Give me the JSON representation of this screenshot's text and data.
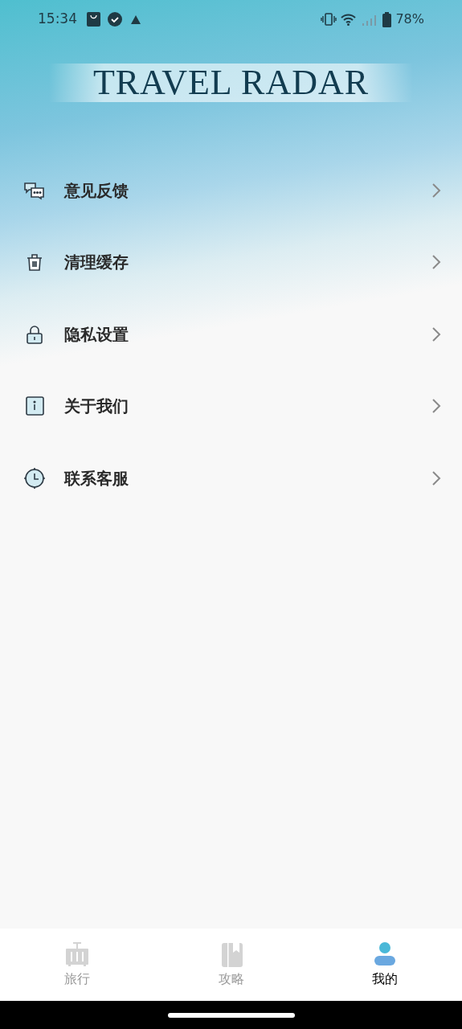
{
  "status_bar": {
    "time": "15:34",
    "battery": "78%"
  },
  "app_title": "TRAVEL RADAR",
  "menu": [
    {
      "kind": "feedback",
      "label": "意见反馈"
    },
    {
      "kind": "cache",
      "label": "清理缓存"
    },
    {
      "kind": "privacy",
      "label": "隐私设置"
    },
    {
      "kind": "about",
      "label": "关于我们"
    },
    {
      "kind": "service",
      "label": "联系客服"
    }
  ],
  "tabs": [
    {
      "kind": "travel",
      "label": "旅行",
      "selected": false
    },
    {
      "kind": "guide",
      "label": "攻略",
      "selected": false
    },
    {
      "kind": "me",
      "label": "我的",
      "selected": true
    }
  ]
}
